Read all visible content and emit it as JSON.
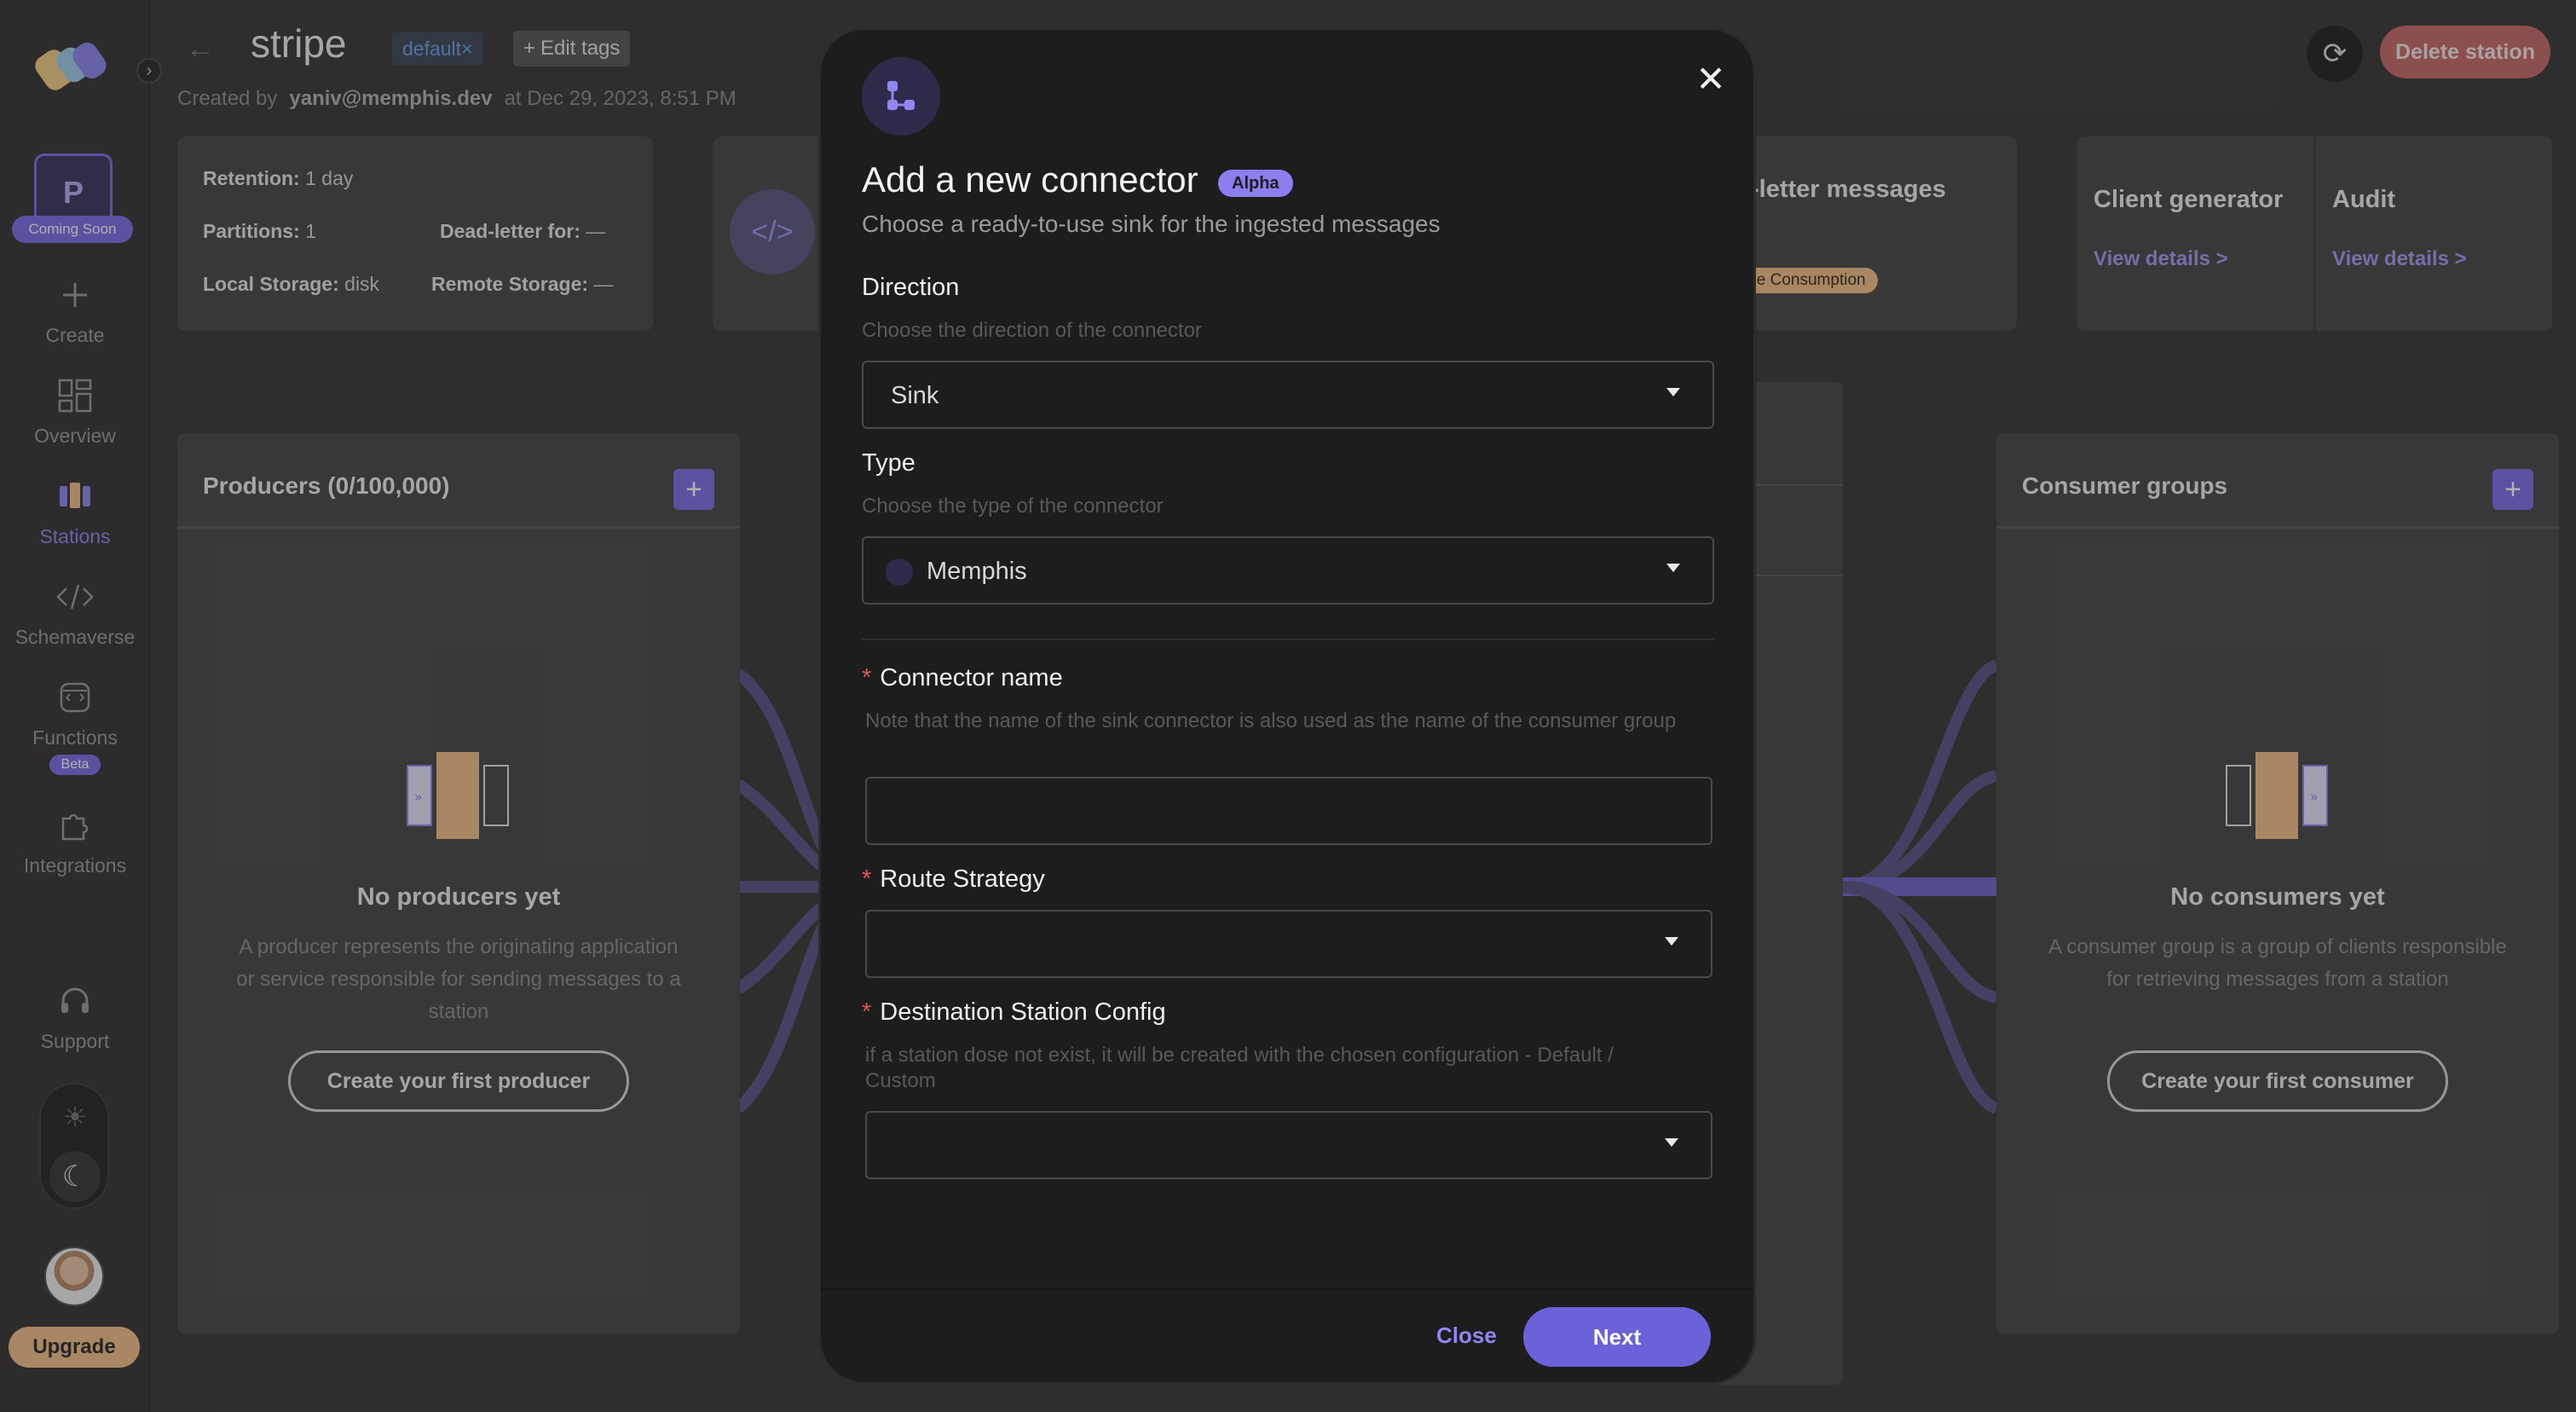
{
  "sidebar": {
    "project_initial": "P",
    "coming_soon": "Coming Soon",
    "items": [
      {
        "label": "Create"
      },
      {
        "label": "Overview"
      },
      {
        "label": "Stations"
      },
      {
        "label": "Schemaverse"
      },
      {
        "label": "Functions",
        "badge": "Beta"
      },
      {
        "label": "Integrations"
      },
      {
        "label": "Support"
      }
    ],
    "upgrade": "Upgrade"
  },
  "header": {
    "title": "stripe",
    "tag": "default",
    "tag_remove": "×",
    "edit_tags": "Edit tags",
    "created_by_label": "Created by",
    "created_by": "yaniv@memphis.dev",
    "created_at": "at Dec 29, 2023, 8:51 PM",
    "delete": "Delete station"
  },
  "info": {
    "retention_label": "Retention:",
    "retention": "1 day",
    "partitions_label": "Partitions:",
    "partitions": "1",
    "deadletter_label": "Dead-letter for:",
    "deadletter": "—",
    "local_label": "Local Storage:",
    "local": "disk",
    "remote_label": "Remote Storage:",
    "remote": "—"
  },
  "deadletter_card": {
    "title": "-letter messages",
    "badge": "ble Consumption"
  },
  "client_generator": {
    "title": "Client generator",
    "link": "View details >"
  },
  "audit": {
    "title": "Audit",
    "link": "View details >"
  },
  "producers": {
    "title": "Producers (0/100,000)",
    "empty_title": "No producers yet",
    "empty_desc": "A producer represents the originating application or service responsible for sending messages to a station",
    "button": "Create your first producer"
  },
  "consumers": {
    "title": "Consumer groups",
    "empty_title": "No consumers yet",
    "empty_desc": "A consumer group is a group of clients responsible for retrieving messages from a station",
    "button": "Create your first consumer"
  },
  "modal": {
    "title": "Add a new connector",
    "badge": "Alpha",
    "subtitle": "Choose a ready-to-use sink for the ingested messages",
    "direction_label": "Direction",
    "direction_help": "Choose the direction of the connector",
    "direction_value": "Sink",
    "type_label": "Type",
    "type_help": "Choose the type of the connector",
    "type_value": "Memphis",
    "name_label": "Connector name",
    "name_help": "Note that the name of the sink connector is also used as the name of the consumer group",
    "name_value": "",
    "route_label": "Route Strategy",
    "route_value": "",
    "dest_label": "Destination Station Config",
    "dest_help": "if a station dose not exist, it will be created with the chosen configuration - Default / Custom",
    "dest_value": "",
    "close": "Close",
    "next": "Next"
  },
  "colors": {
    "accent": "#7b6fe8",
    "delete": "#c86b6b",
    "upgrade": "#f4c18a",
    "modal_bg": "#1d1d1d"
  }
}
